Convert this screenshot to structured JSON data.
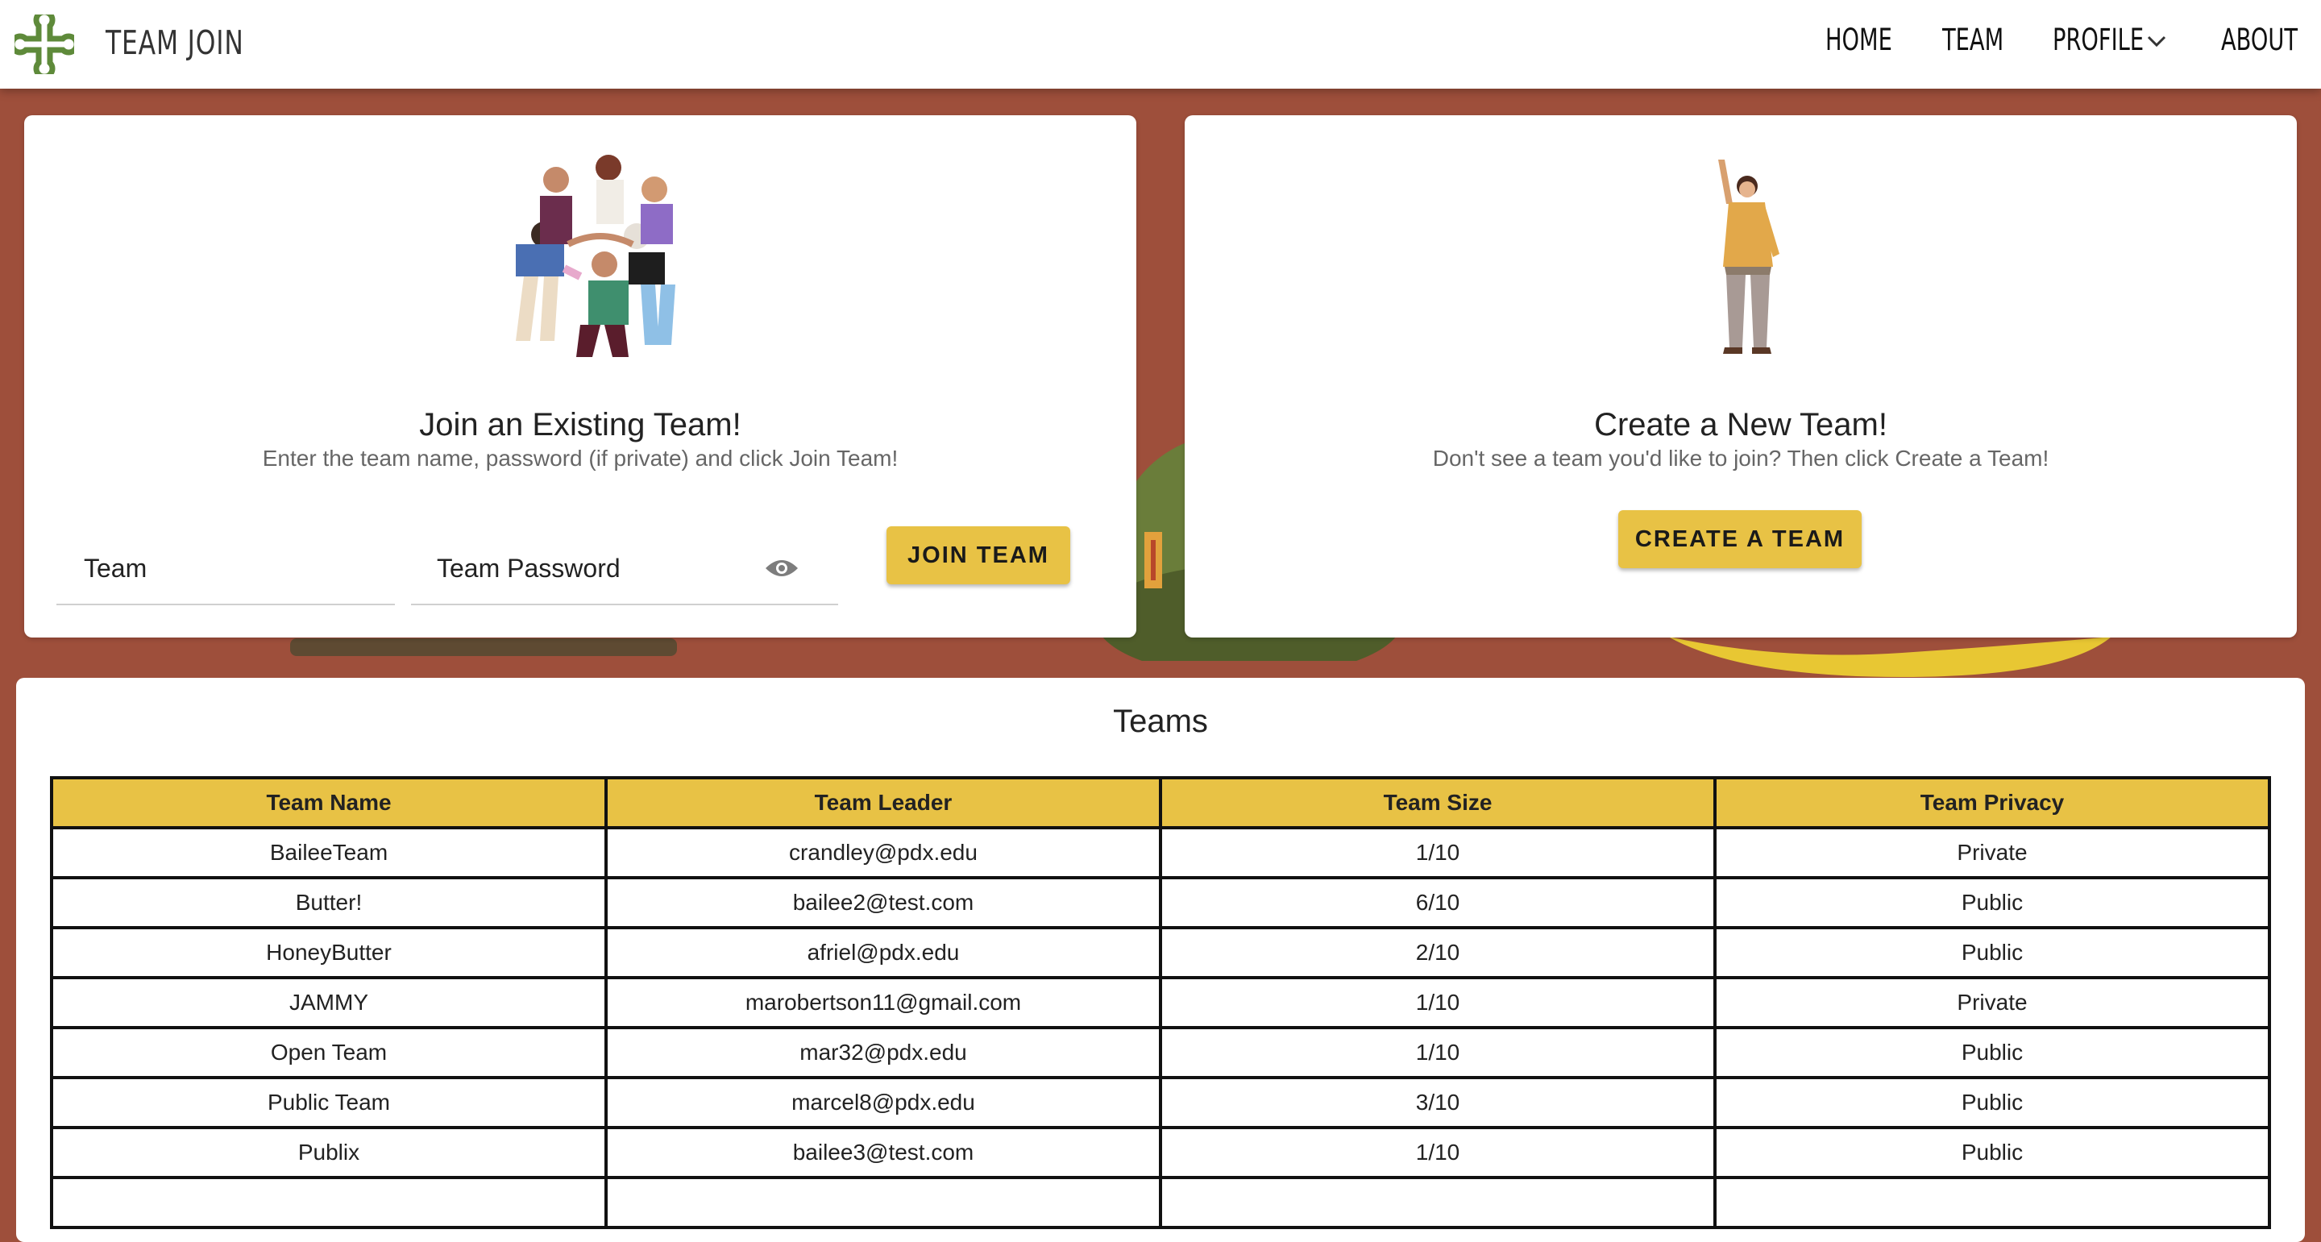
{
  "app": {
    "brand": "TEAM JOIN",
    "accent_color": "#e8c245",
    "background_color": "#9e4f3b"
  },
  "nav": {
    "items": [
      {
        "label": "HOME"
      },
      {
        "label": "TEAM"
      },
      {
        "label": "PROFILE",
        "icon": "chevron-down-icon"
      },
      {
        "label": "ABOUT"
      }
    ]
  },
  "join_card": {
    "illustration": "group-of-people-illustration",
    "title": "Join an Existing Team!",
    "subtitle": "Enter the team name, password (if private) and click Join Team!",
    "team_field_label": "Team",
    "password_field_label": "Team Password",
    "password_toggle_icon": "eye-icon",
    "button_label": "JOIN TEAM"
  },
  "create_card": {
    "illustration": "waving-person-illustration",
    "title": "Create a New Team!",
    "subtitle": "Don't see a team you'd like to join? Then click Create a Team!",
    "button_label": "CREATE A TEAM"
  },
  "teams": {
    "title": "Teams",
    "columns": [
      "Team Name",
      "Team Leader",
      "Team Size",
      "Team Privacy"
    ],
    "rows": [
      [
        "BaileeTeam",
        "crandley@pdx.edu",
        "1/10",
        "Private"
      ],
      [
        "Butter!",
        "bailee2@test.com",
        "6/10",
        "Public"
      ],
      [
        "HoneyButter",
        "afriel@pdx.edu",
        "2/10",
        "Public"
      ],
      [
        "JAMMY",
        "marobertson11@gmail.com",
        "1/10",
        "Private"
      ],
      [
        "Open Team",
        "mar32@pdx.edu",
        "1/10",
        "Public"
      ],
      [
        "Public Team",
        "marcel8@pdx.edu",
        "3/10",
        "Public"
      ],
      [
        "Publix",
        "bailee3@test.com",
        "1/10",
        "Public"
      ],
      [
        "",
        "",
        "",
        ""
      ]
    ]
  }
}
